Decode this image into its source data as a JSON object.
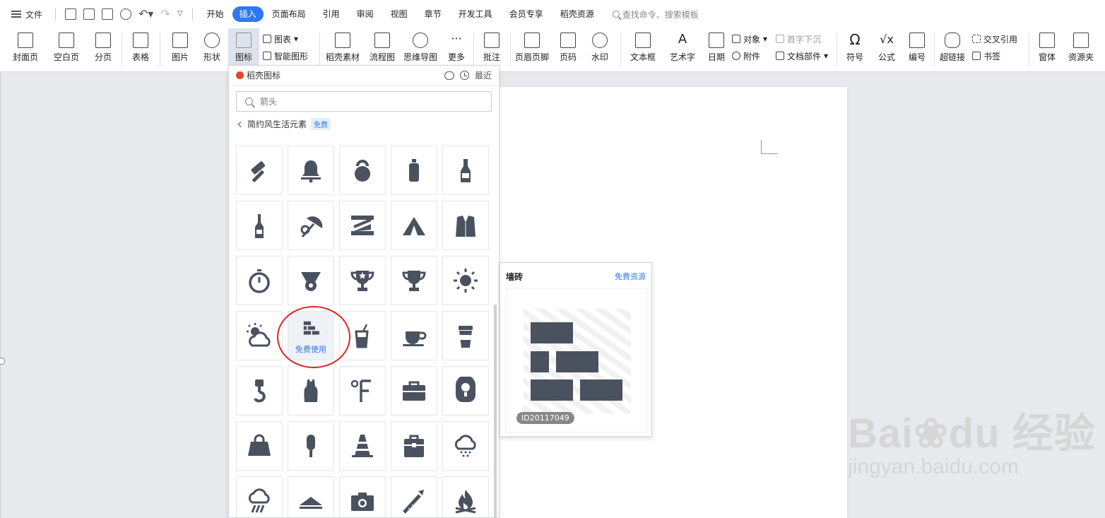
{
  "menubar": {
    "file_label": "文件",
    "tabs": [
      "开始",
      "插入",
      "页面布局",
      "引用",
      "审阅",
      "视图",
      "章节",
      "开发工具",
      "会员专享",
      "稻壳资源"
    ],
    "active_tab": "插入",
    "search_placeholder": "查找命令、搜索模板"
  },
  "ribbon": {
    "cover": "封面页",
    "blank": "空白页",
    "pagebreak": "分页",
    "table": "表格",
    "picture": "图片",
    "shape": "形状",
    "icon": "图标",
    "chart": "图表",
    "smartart": "智能图形",
    "docer_material": "稻壳素材",
    "flowchart": "流程图",
    "mindmap": "思维导图",
    "more": "更多",
    "comment": "批注",
    "header_footer": "页眉页脚",
    "page_number": "页码",
    "watermark": "水印",
    "textbox": "文本框",
    "wordart": "艺术字",
    "date": "日期",
    "object": "对象",
    "attachment": "附件",
    "dropcap": "首字下沉",
    "doc_parts": "文档部件",
    "symbol": "符号",
    "formula": "公式",
    "numbering": "编号",
    "hyperlink": "超链接",
    "crossref": "交叉引用",
    "bookmark": "书签",
    "window": "窗体",
    "resource_folder": "资源夹"
  },
  "panel": {
    "brand": "稻壳图标",
    "recent": "最近",
    "search_placeholder": "箭头",
    "category": "简约风生活元素",
    "free_badge": "免费",
    "hover_label": "免费使用",
    "icons": [
      "hammer",
      "bell",
      "kettlebell",
      "sport-bottle",
      "beer-bottle",
      "wine-bottle",
      "beach-umbrella",
      "ruler",
      "tent",
      "suit",
      "stopwatch",
      "medal",
      "trophy-star",
      "trophy",
      "sun",
      "sun-cloud",
      "brick-wall",
      "drink-cup",
      "coffee-cup",
      "coffee-to-go",
      "crane-hook",
      "tank-top",
      "fahrenheit",
      "toolbox",
      "camera-bag",
      "handbag",
      "popsicle",
      "traffic-cone",
      "briefcase",
      "snow-cloud",
      "rain-cloud",
      "roof",
      "camera",
      "firework-rocket",
      "campfire"
    ]
  },
  "preview": {
    "title": "墙砖",
    "resource_link": "免费资源",
    "id": "ID20117049"
  },
  "watermark": {
    "brand": "Bai",
    "brand2": "du",
    "jingyan": "经验",
    "url": "jingyan.baidu.com"
  }
}
